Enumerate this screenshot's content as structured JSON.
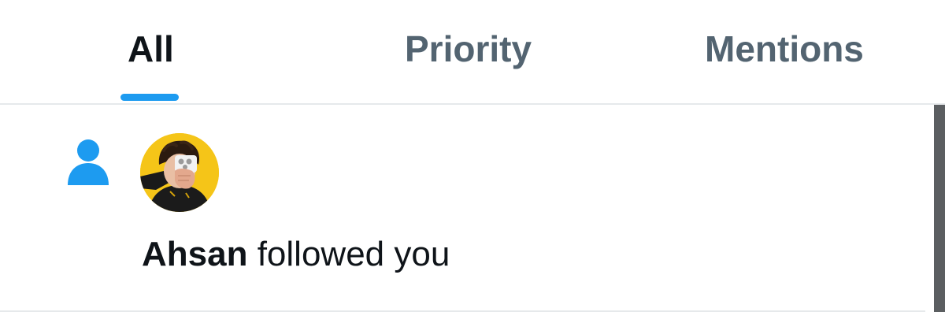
{
  "tabs": [
    {
      "label": "All",
      "active": true
    },
    {
      "label": "Priority",
      "active": false
    },
    {
      "label": "Mentions",
      "active": false
    }
  ],
  "notification": {
    "type_icon": "person-follow-icon",
    "avatar_icon": "user-avatar",
    "user_name": "Ahsan",
    "action_text": " followed you"
  },
  "colors": {
    "accent": "#1d9bf0",
    "text_primary": "#0f1419",
    "text_secondary": "#536471",
    "divider": "#e6e9eb",
    "avatar_bg": "#f5c518"
  }
}
